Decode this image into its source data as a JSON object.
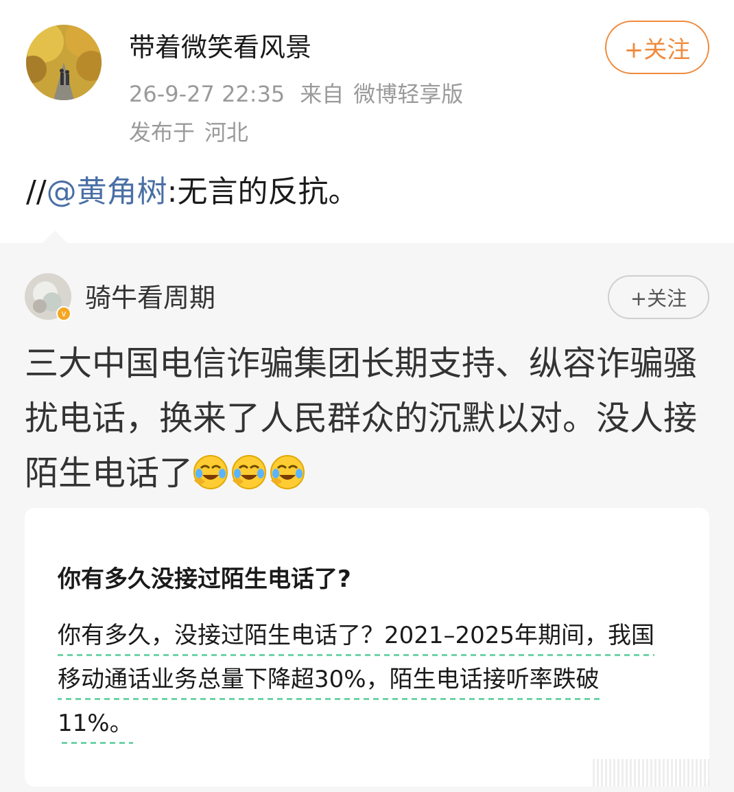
{
  "post": {
    "author": "带着微笑看风景",
    "timestamp": "26-9-27 22:35",
    "source_prefix": "来自",
    "source": "微博轻享版",
    "location_prefix": "发布于",
    "location": "河北",
    "follow_label": "+关注",
    "repost_prefix": "//",
    "repost_mention": "@黄角树",
    "repost_body": ":无言的反抗。"
  },
  "quoted": {
    "author": "骑牛看周期",
    "follow_label": "+关注",
    "text": "三大中国电信诈骗集团长期支持、纵容诈骗骚扰电话，换来了人民群众的沉默以对。没人接陌生电话了",
    "emojis": [
      "laugh-cry-emoji",
      "laugh-cry-emoji",
      "laugh-cry-emoji"
    ],
    "card": {
      "title": "你有多久没接过陌生电话了?",
      "body": "你有多久，没接过陌生电话了？2021–2025年期间，我国移动通话业务总量下降超30%，陌生电话接听率跌破 11%。"
    }
  },
  "colors": {
    "accent_orange": "#f08a3c",
    "mention_blue": "#4a6fa5",
    "meta_gray": "#9a9a9a",
    "quote_bg": "#f6f6f6",
    "underline_green": "#6fd3a8"
  }
}
